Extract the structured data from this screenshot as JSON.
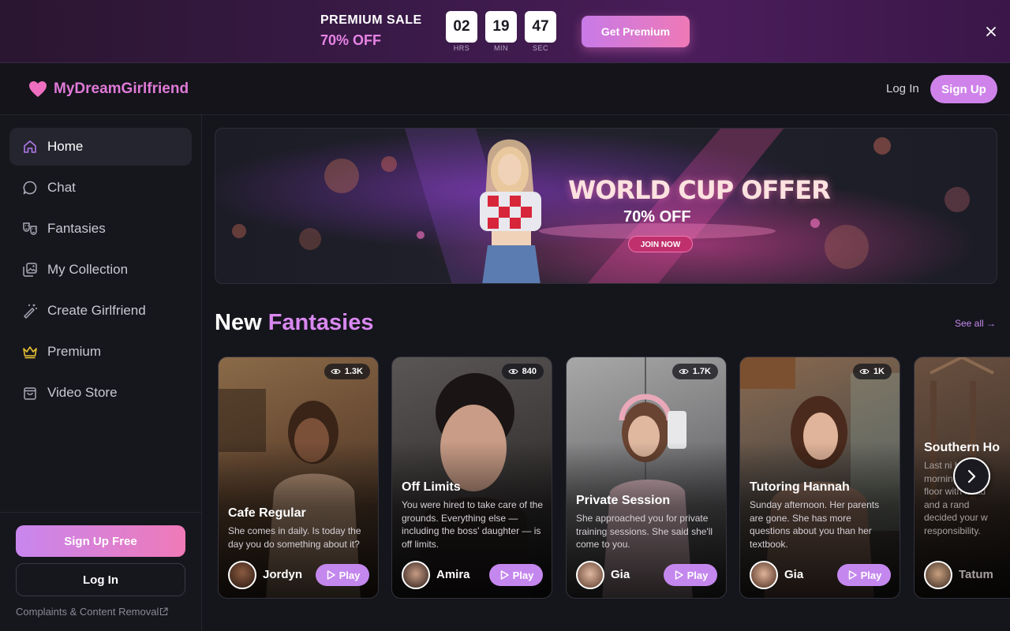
{
  "promo": {
    "title": "PREMIUM SALE",
    "discount": "70% OFF",
    "timer": [
      {
        "value": "02",
        "label": "HRS"
      },
      {
        "value": "19",
        "label": "MIN"
      },
      {
        "value": "47",
        "label": "SEC"
      }
    ],
    "cta": "Get Premium",
    "close_icon": "close-icon"
  },
  "header": {
    "brand": "MyDreamGirlfriend",
    "login": "Log In",
    "signup": "Sign Up"
  },
  "sidebar": {
    "items": [
      {
        "label": "Home",
        "icon": "home-icon",
        "active": true
      },
      {
        "label": "Chat",
        "icon": "chat-bubble-icon"
      },
      {
        "label": "Fantasies",
        "icon": "theater-masks-icon"
      },
      {
        "label": "My Collection",
        "icon": "image-collection-icon"
      },
      {
        "label": "Create Girlfriend",
        "icon": "magic-wand-icon"
      },
      {
        "label": "Premium",
        "icon": "crown-icon"
      },
      {
        "label": "Video Store",
        "icon": "shopping-bag-icon"
      }
    ],
    "signup_free": "Sign Up Free",
    "login": "Log In",
    "footer_link": "Complaints & Content Removal"
  },
  "banner": {
    "title": "WORLD CUP OFFER",
    "discount": "70% OFF",
    "cta": "JOIN NOW"
  },
  "section": {
    "title_plain": "New",
    "title_accent": "Fantasies",
    "see_all": "See all →"
  },
  "cards": [
    {
      "title": "Cafe Regular",
      "description": "She comes in daily. Is today the day you do something about it?",
      "views": "1.3K",
      "character": "Jordyn",
      "play": "Play"
    },
    {
      "title": "Off Limits",
      "description": "You were hired to take care of the grounds. Everything else — including the boss' daughter — is off limits.",
      "views": "840",
      "character": "Amira",
      "play": "Play"
    },
    {
      "title": "Private Session",
      "description": "She approached you for private training sessions. She said she'll come to you.",
      "views": "1.7K",
      "character": "Gia",
      "play": "Play"
    },
    {
      "title": "Tutoring Hannah",
      "description": "Sunday afternoon. Her parents are gone. She has more questions about you than her textbook.",
      "views": "1K",
      "character": "Gia",
      "play": "Play"
    },
    {
      "title": "Southern Ho",
      "description": "Last ni booze morning barn floor with head and a rand decided your w responsibility.",
      "views": "",
      "character": "Tatum",
      "play": "Play"
    }
  ],
  "colors": {
    "accent": "#cf83ea",
    "accent_pink": "#ee79b6",
    "background": "#15151c",
    "sidebar": "#16161d"
  }
}
